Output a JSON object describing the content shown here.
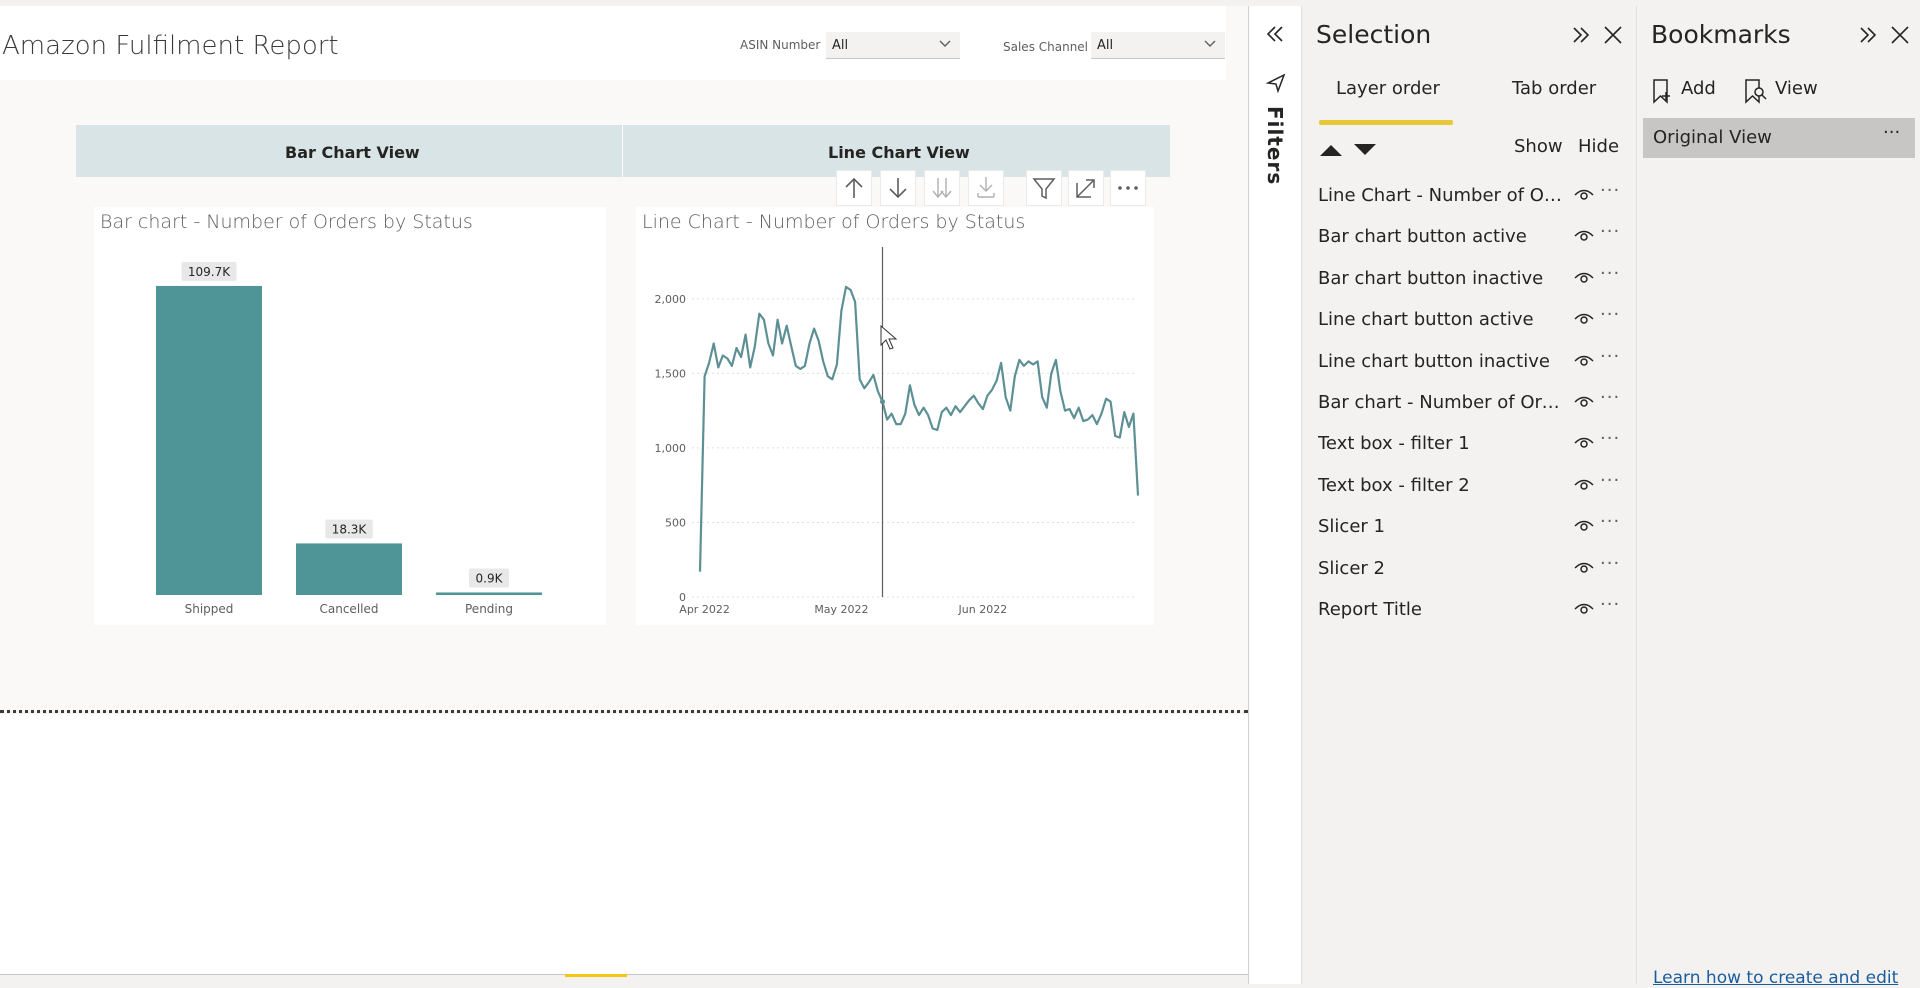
{
  "report": {
    "title": "Amazon Fulfilment Report",
    "slicers": [
      {
        "label": "ASIN Number",
        "value": "All"
      },
      {
        "label": "Sales Channel",
        "value": "All"
      }
    ]
  },
  "tabs": {
    "bar": "Bar Chart View",
    "line": "Line Chart View"
  },
  "bar_visual": {
    "title": "Bar chart - Number of Orders by Status"
  },
  "line_visual": {
    "title": "Line Chart - Number of Orders by Status"
  },
  "chart_data": [
    {
      "type": "bar",
      "title": "Bar chart - Number of Orders by Status",
      "categories": [
        "Shipped",
        "Cancelled",
        "Pending"
      ],
      "values": [
        109.7,
        18.3,
        0.9
      ],
      "data_labels": [
        "109.7K",
        "18.3K",
        "0.9K"
      ],
      "units": "K",
      "color": "#4f9496",
      "ylim": [
        0,
        115
      ]
    },
    {
      "type": "line",
      "title": "Line Chart - Number of Orders by Status",
      "x_start": "2022-03-31",
      "x_ticks": [
        "Apr 2022",
        "May 2022",
        "Jun 2022"
      ],
      "y_ticks": [
        "0",
        "500",
        "1,000",
        "1,500",
        "2,000"
      ],
      "ylim": [
        0,
        2200
      ],
      "color": "#5d9094",
      "values": [
        170,
        1480,
        1570,
        1700,
        1540,
        1620,
        1600,
        1550,
        1670,
        1610,
        1760,
        1540,
        1680,
        1900,
        1860,
        1700,
        1620,
        1860,
        1700,
        1820,
        1680,
        1550,
        1530,
        1550,
        1700,
        1800,
        1720,
        1580,
        1480,
        1460,
        1560,
        1920,
        2080,
        2060,
        1980,
        1460,
        1400,
        1440,
        1490,
        1380,
        1310,
        1190,
        1230,
        1160,
        1160,
        1230,
        1420,
        1290,
        1220,
        1270,
        1220,
        1130,
        1120,
        1240,
        1270,
        1220,
        1280,
        1240,
        1280,
        1320,
        1350,
        1300,
        1260,
        1350,
        1390,
        1450,
        1570,
        1340,
        1250,
        1480,
        1590,
        1550,
        1580,
        1560,
        1580,
        1340,
        1270,
        1500,
        1590,
        1380,
        1250,
        1260,
        1200,
        1270,
        1180,
        1190,
        1220,
        1160,
        1230,
        1330,
        1310,
        1080,
        1070,
        1240,
        1140,
        1230,
        680
      ]
    }
  ],
  "selection_pane": {
    "title": "Selection",
    "tabs": [
      "Layer order",
      "Tab order"
    ],
    "show_label": "Show",
    "hide_label": "Hide",
    "layers": [
      "Line Chart - Number of Orders by Status",
      "Bar chart button active",
      "Bar chart button inactive",
      "Line chart button active",
      "Line chart button inactive",
      "Bar chart - Number of Orders by Status",
      "Text box - filter 1",
      "Text box - filter 2",
      "Slicer 1",
      "Slicer 2",
      "Report Title"
    ]
  },
  "filters_pane": {
    "label": "Filters"
  },
  "bookmarks_pane": {
    "title": "Bookmarks",
    "add_label": "Add",
    "view_label": "View",
    "items": [
      "Original View"
    ],
    "learn_link": "Learn how to create and edit"
  }
}
